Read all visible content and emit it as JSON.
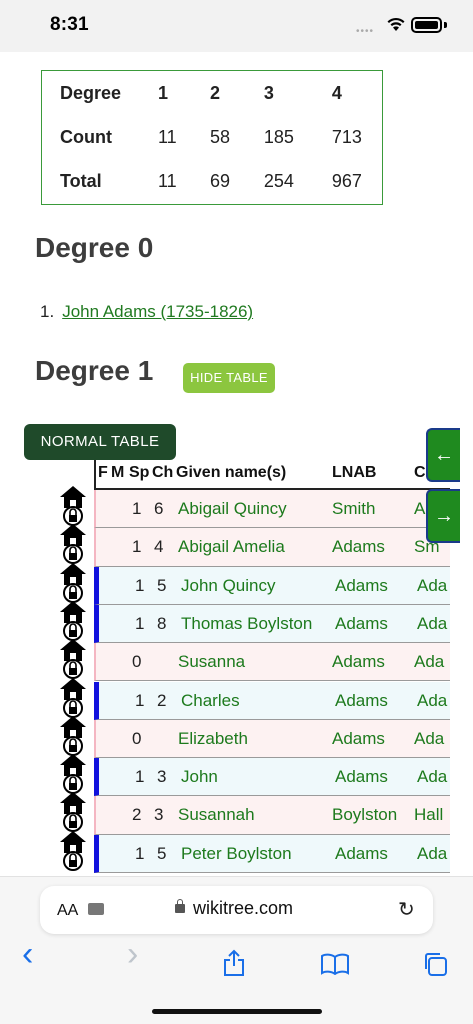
{
  "status_bar": {
    "time": "8:31"
  },
  "summary_table": {
    "rows": [
      {
        "label": "Degree",
        "values": [
          "1",
          "2",
          "3",
          "4"
        ]
      },
      {
        "label": "Count",
        "values": [
          "11",
          "58",
          "185",
          "713"
        ]
      },
      {
        "label": "Total",
        "values": [
          "11",
          "69",
          "254",
          "967"
        ]
      }
    ]
  },
  "degree0": {
    "heading": "Degree 0",
    "items": [
      {
        "number": "1.",
        "link": "John Adams (1735-1826)"
      }
    ]
  },
  "degree1": {
    "heading": "Degree 1",
    "hide_table_label": "HIDE TABLE",
    "normal_table_label": "NORMAL TABLE"
  },
  "relatives_table": {
    "headers": [
      "F",
      "M",
      "Sp",
      "Ch",
      "Given name(s)",
      "LNAB",
      "Cl"
    ],
    "rows": [
      {
        "sp": "1",
        "ch": "6",
        "given": "Abigail Quincy",
        "lnab": "Smith",
        "cl": "A",
        "side": "#f4b6c2",
        "bg": "#fdf2f2"
      },
      {
        "sp": "1",
        "ch": "4",
        "given": "Abigail Amelia",
        "lnab": "Adams",
        "cl": "Sm",
        "side": "#f4b6c2",
        "bg": "#fdf2f2"
      },
      {
        "sp": "1",
        "ch": "5",
        "given": "John Quincy",
        "lnab": "Adams",
        "cl": "Ada",
        "side": "#1111dd",
        "bg": "#eff9fb"
      },
      {
        "sp": "1",
        "ch": "8",
        "given": "Thomas Boylston",
        "lnab": "Adams",
        "cl": "Ada",
        "side": "#1111dd",
        "bg": "#eff9fb"
      },
      {
        "sp": "0",
        "ch": "",
        "given": "Susanna",
        "lnab": "Adams",
        "cl": "Ada",
        "side": "#f4b6c2",
        "bg": "#fdf2f2"
      },
      {
        "sp": "1",
        "ch": "2",
        "given": "Charles",
        "lnab": "Adams",
        "cl": "Ada",
        "side": "#1111dd",
        "bg": "#eff9fb"
      },
      {
        "sp": "0",
        "ch": "",
        "given": "Elizabeth",
        "lnab": "Adams",
        "cl": "Ada",
        "side": "#f4b6c2",
        "bg": "#fdf2f2"
      },
      {
        "sp": "1",
        "ch": "3",
        "given": "John",
        "lnab": "Adams",
        "cl": "Ada",
        "side": "#1111dd",
        "bg": "#eff9fb"
      },
      {
        "sp": "2",
        "ch": "3",
        "given": "Susannah",
        "lnab": "Boylston",
        "cl": "Hall",
        "side": "#f4b6c2",
        "bg": "#fdf2f2"
      },
      {
        "sp": "1",
        "ch": "5",
        "given": "Peter Boylston",
        "lnab": "Adams",
        "cl": "Ada",
        "side": "#1111dd",
        "bg": "#eff9fb"
      }
    ]
  },
  "side_nav": {
    "left_arrow": "←",
    "right_arrow": "→"
  },
  "safari": {
    "aa_label": "AA",
    "url": "wikitree.com",
    "reload_icon": "↻",
    "toolbar": {
      "back": "‹",
      "forward": "›"
    }
  }
}
